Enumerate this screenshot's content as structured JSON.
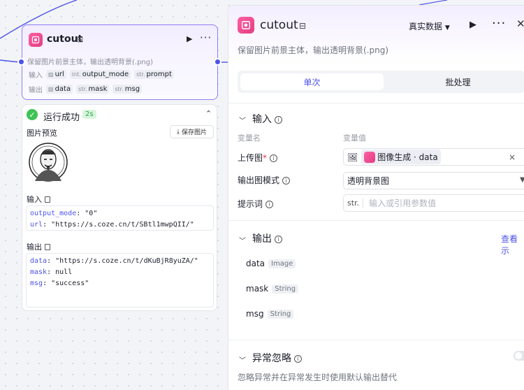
{
  "node": {
    "title": "cutout",
    "description": "保留图片前景主体，输出透明背景(.png)",
    "input_label": "输入",
    "output_label": "输出",
    "inputs": [
      {
        "type": "",
        "name": "url"
      },
      {
        "type": "int.",
        "name": "output_mode"
      },
      {
        "type": "str.",
        "name": "prompt"
      }
    ],
    "outputs": [
      {
        "type": "",
        "name": "data"
      },
      {
        "type": "str.",
        "name": "mask"
      },
      {
        "type": "str.",
        "name": "msg"
      }
    ]
  },
  "result": {
    "status": "运行成功",
    "time": "2s",
    "preview_label": "图片预览",
    "save_label": "保存图片",
    "input_title": "输入",
    "input_lines": [
      {
        "key": "output_mode",
        "value": ": \"0\""
      },
      {
        "key": "url",
        "value": ": \"https://s.coze.cn/t/SBtl1mwpQII/\""
      }
    ],
    "output_title": "输出",
    "output_lines": [
      {
        "key": "data",
        "value": ": \"https://s.coze.cn/t/dKuBjR8yuZA/\""
      },
      {
        "key": "mask",
        "value": ": null"
      },
      {
        "key": "msg",
        "value": ": \"success\""
      }
    ]
  },
  "panel": {
    "title": "cutout",
    "mode": "真实数据",
    "description": "保留图片前景主体，输出透明背景(.png)",
    "tabs": [
      "单次",
      "批处理"
    ],
    "input_section": "输入",
    "col_name": "变量名",
    "col_value": "变量值",
    "rows": {
      "upload_label": "上传图",
      "upload_value": "图像生成 · data",
      "mode_label": "输出图模式",
      "mode_value": "透明背景图",
      "prompt_label": "提示词",
      "prompt_tag": "str.",
      "prompt_placeholder": "输入或引用参数值"
    },
    "output_section": "输出",
    "view_link": "查看示",
    "outputs": [
      {
        "name": "data",
        "type": "Image"
      },
      {
        "name": "mask",
        "type": "String"
      },
      {
        "name": "msg",
        "type": "String"
      }
    ],
    "exception_section": "异常忽略",
    "exception_desc": "忽略异常并在异常发生时使用默认输出替代"
  },
  "colors": {
    "accent": "#4d53e8",
    "success": "#3ec254",
    "brand": "#e23d84"
  }
}
